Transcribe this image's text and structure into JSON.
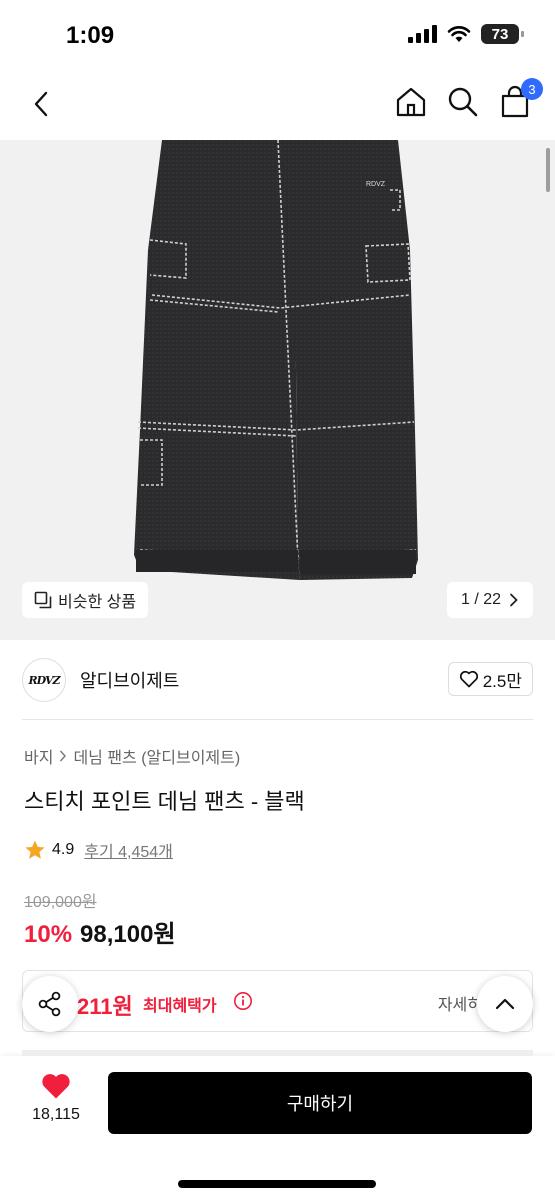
{
  "status": {
    "time": "1:09",
    "battery": "73"
  },
  "nav": {
    "cart_count": "3"
  },
  "image": {
    "similar_label": "비슷한 상품",
    "counter": "1 / 22"
  },
  "brand": {
    "logo_text": "RDVZ",
    "name": "알디브이제트",
    "likes": "2.5만"
  },
  "breadcrumb": {
    "category": "바지",
    "subcategory": "데님 팬츠 (알디브이제트)"
  },
  "product": {
    "title": "스티치 포인트 데님 팬츠 - 블랙",
    "rating": "4.9",
    "reviews": "후기 4,454개",
    "original_price": "109,000원",
    "discount": "10%",
    "price": "98,100원"
  },
  "benefit": {
    "amount": "211원",
    "label": "최대혜택가",
    "detail": "자세히"
  },
  "bottom": {
    "like_count": "18,115",
    "buy_label": "구매하기"
  },
  "colors": {
    "accent_red": "#f0203d",
    "badge_blue": "#2f6bff"
  }
}
